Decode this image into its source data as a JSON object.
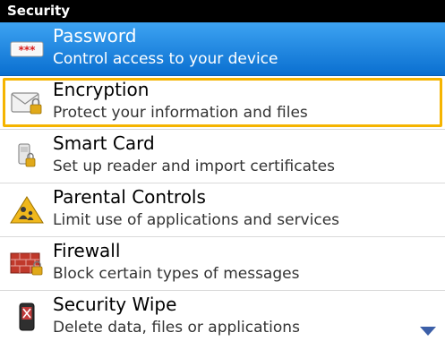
{
  "header": {
    "title": "Security"
  },
  "items": [
    {
      "title": "Password",
      "subtitle": "Control access to your device",
      "icon": "password-icon",
      "state": "selected"
    },
    {
      "title": "Encryption",
      "subtitle": "Protect your information and files",
      "icon": "envelope-lock-icon",
      "state": "focused"
    },
    {
      "title": "Smart Card",
      "subtitle": "Set up reader and import certificates",
      "icon": "smart-card-reader-icon",
      "state": "normal"
    },
    {
      "title": "Parental Controls",
      "subtitle": "Limit use of applications and services",
      "icon": "parental-controls-icon",
      "state": "normal"
    },
    {
      "title": "Firewall",
      "subtitle": "Block certain types of messages",
      "icon": "firewall-icon",
      "state": "normal"
    },
    {
      "title": "Security Wipe",
      "subtitle": "Delete data, files or applications",
      "icon": "security-wipe-icon",
      "state": "normal"
    }
  ],
  "colors": {
    "header_bg": "#000000",
    "selected_bg": "#1a86e0",
    "focus_border": "#f5b400",
    "scroll_arrow": "#3c5fa8"
  },
  "scroll": {
    "more_below_icon": "chevron-down-icon"
  }
}
